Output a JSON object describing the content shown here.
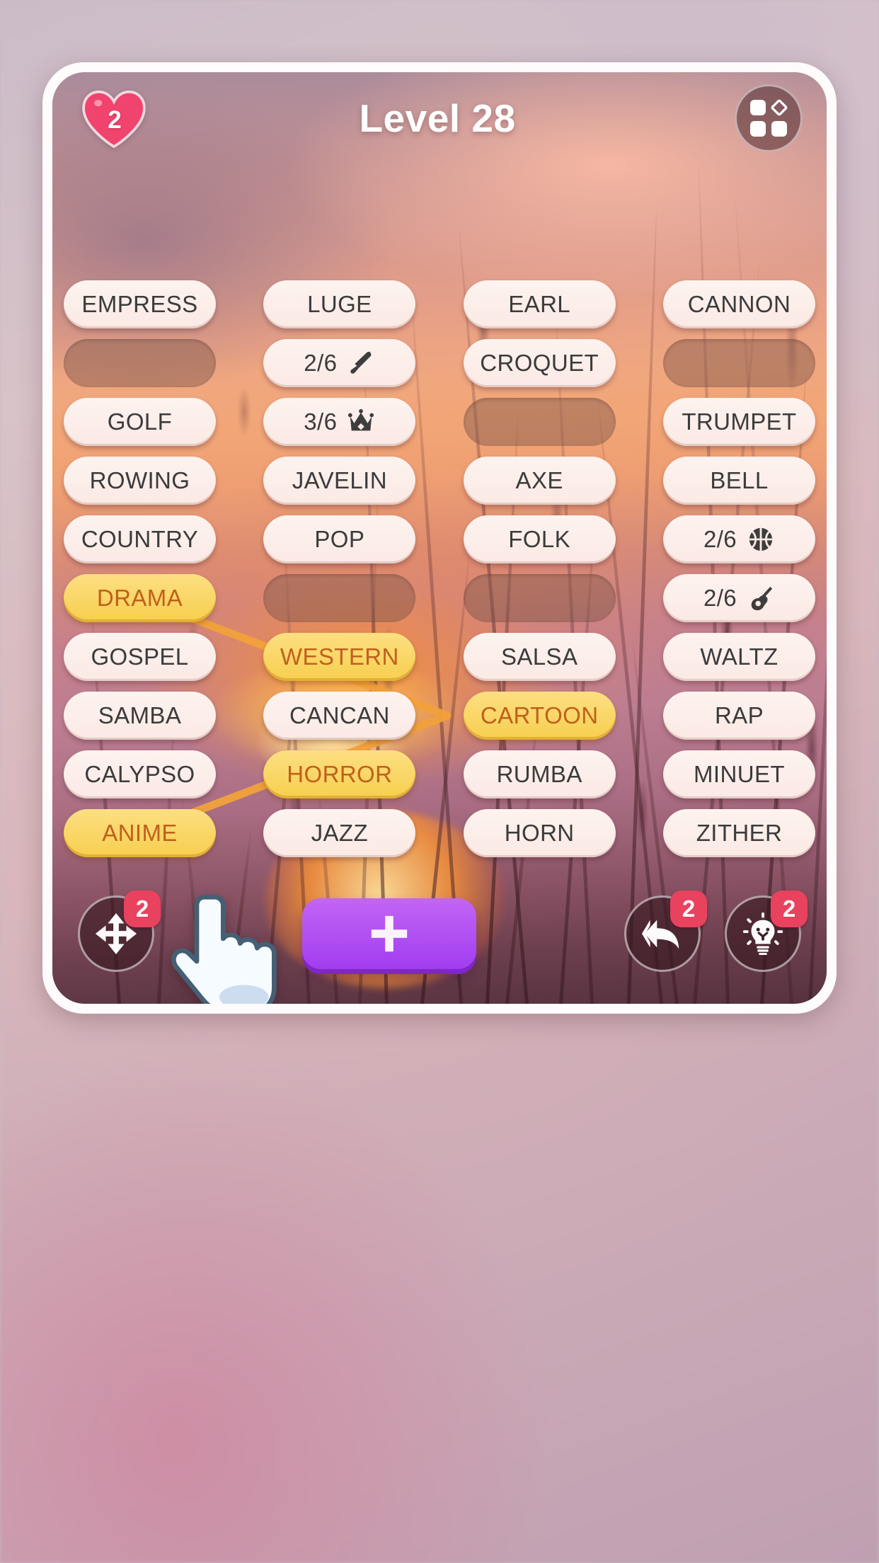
{
  "header": {
    "hearts_count": "2",
    "level_title": "Level 28",
    "menu_icon": "grid-menu-icon",
    "heart_icon": "heart-icon"
  },
  "board": {
    "rows": [
      [
        {
          "label": "EMPRESS",
          "state": "normal"
        },
        {
          "label": "LUGE",
          "state": "normal"
        },
        {
          "label": "EARL",
          "state": "normal"
        },
        {
          "label": "CANNON",
          "state": "normal"
        }
      ],
      [
        {
          "label": "",
          "state": "empty"
        },
        {
          "label": "2/6",
          "state": "counter",
          "icon": "knife-icon"
        },
        {
          "label": "CROQUET",
          "state": "normal"
        },
        {
          "label": "",
          "state": "empty"
        }
      ],
      [
        {
          "label": "GOLF",
          "state": "normal"
        },
        {
          "label": "3/6",
          "state": "counter",
          "icon": "crown-icon"
        },
        {
          "label": "",
          "state": "empty"
        },
        {
          "label": "TRUMPET",
          "state": "normal"
        }
      ],
      [
        {
          "label": "ROWING",
          "state": "normal"
        },
        {
          "label": "JAVELIN",
          "state": "normal"
        },
        {
          "label": "AXE",
          "state": "normal"
        },
        {
          "label": "BELL",
          "state": "normal"
        }
      ],
      [
        {
          "label": "COUNTRY",
          "state": "normal"
        },
        {
          "label": "POP",
          "state": "normal"
        },
        {
          "label": "FOLK",
          "state": "normal"
        },
        {
          "label": "2/6",
          "state": "counter",
          "icon": "basketball-icon"
        }
      ],
      [
        {
          "label": "DRAMA",
          "state": "selected"
        },
        {
          "label": "",
          "state": "empty"
        },
        {
          "label": "",
          "state": "empty"
        },
        {
          "label": "2/6",
          "state": "counter",
          "icon": "guitar-icon"
        }
      ],
      [
        {
          "label": "GOSPEL",
          "state": "normal"
        },
        {
          "label": "WESTERN",
          "state": "selected"
        },
        {
          "label": "SALSA",
          "state": "normal"
        },
        {
          "label": "WALTZ",
          "state": "normal"
        }
      ],
      [
        {
          "label": "SAMBA",
          "state": "normal"
        },
        {
          "label": "CANCAN",
          "state": "normal"
        },
        {
          "label": "CARTOON",
          "state": "selected"
        },
        {
          "label": "RAP",
          "state": "normal"
        }
      ],
      [
        {
          "label": "CALYPSO",
          "state": "normal"
        },
        {
          "label": "HORROR",
          "state": "selected"
        },
        {
          "label": "RUMBA",
          "state": "normal"
        },
        {
          "label": "MINUET",
          "state": "normal"
        }
      ],
      [
        {
          "label": "ANIME",
          "state": "selected"
        },
        {
          "label": "JAZZ",
          "state": "normal"
        },
        {
          "label": "HORN",
          "state": "normal"
        },
        {
          "label": "ZITHER",
          "state": "normal"
        }
      ]
    ],
    "chain": [
      "DRAMA",
      "WESTERN",
      "CARTOON",
      "HORROR",
      "ANIME"
    ]
  },
  "bottombar": {
    "shuffle": {
      "icon": "move-arrows-icon",
      "badge": "2"
    },
    "add": {
      "icon": "plus-icon"
    },
    "undo": {
      "icon": "undo-double-arrow-icon",
      "badge": "2"
    },
    "hint": {
      "icon": "lightbulb-icon",
      "badge": "2"
    }
  },
  "cursor": {
    "icon": "pointing-hand-icon"
  },
  "colors": {
    "selected_tile": "#f7cf4e",
    "selected_text": "#c0601b",
    "tile_bg": "#fbe9e4",
    "tile_text": "#3b3b3b",
    "badge": "#e8425f",
    "add_button": "#a13df0",
    "heart": "#f0436e",
    "link_line": "#f1a13a"
  }
}
